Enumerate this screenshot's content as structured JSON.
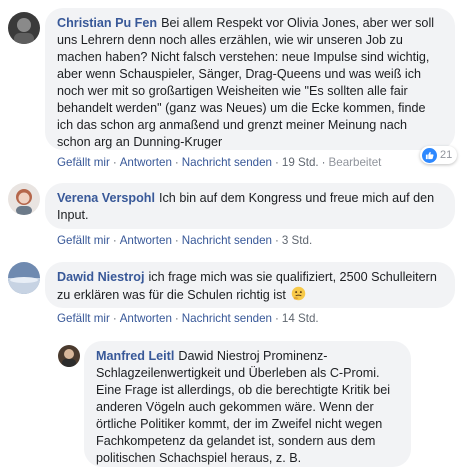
{
  "comments": [
    {
      "author": "Christian Pu Fen",
      "text": "Bei allem Respekt vor Olivia Jones, aber wer soll uns Lehrern denn noch alles erzählen, wie wir unseren Job zu machen haben? Nicht falsch verstehen: neue Impulse sind wichtig, aber wenn Schauspieler, Sänger, Drag-Queens und was weiß ich noch wer mit so großartigen Weisheiten wie \"Es sollten alle fair behandelt werden\" (ganz was Neues) um die Ecke kommen, finde ich das schon arg anmaßend und grenzt meiner Meinung nach schon arg an Dunning-Kruger",
      "like_label": "Gefällt mir",
      "reply_label": "Antworten",
      "message_label": "Nachricht senden",
      "time": "19 Std.",
      "edited_label": "Bearbeitet",
      "reaction_count": "21",
      "reaction_icon": "like-icon"
    },
    {
      "author": "Verena Verspohl",
      "text": "Ich bin auf dem Kongress und freue mich auf den Input.",
      "like_label": "Gefällt mir",
      "reply_label": "Antworten",
      "message_label": "Nachricht senden",
      "time": "3 Std."
    },
    {
      "author": "Dawid Niestroj",
      "text": "ich frage mich was sie qualifiziert, 2500 Schulleitern zu erklären was für die Schulen richtig ist",
      "emoji": "thinking-face-emoji",
      "like_label": "Gefällt mir",
      "reply_label": "Antworten",
      "message_label": "Nachricht senden",
      "time": "14 Std."
    }
  ],
  "reply": {
    "author": "Manfred Leitl",
    "text": "Dawid Niestroj Prominenz-Schlagzeilenwertigkeit und Überleben als C-Promi. Eine Frage ist allerdings, ob die berechtigte Kritik bei anderen Vögeln auch gekommen wäre. Wenn der örtliche Politiker kommt, der im Zweifel nicht wegen Fachkompetenz da gelandet ist, sondern aus dem politischen Schachspiel heraus, z. B."
  },
  "separator": "·",
  "colors": {
    "bubble": "#f2f3f5",
    "link": "#385898",
    "meta": "#606770",
    "like": "#2d88ff"
  }
}
